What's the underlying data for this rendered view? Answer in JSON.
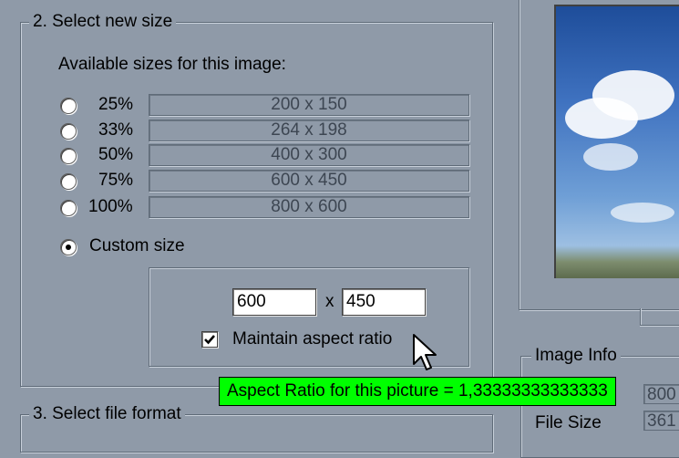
{
  "select_size": {
    "legend": "2. Select new size",
    "available_label": "Available sizes for this image:",
    "options": [
      {
        "percent": "25%",
        "dims": "200 x 150"
      },
      {
        "percent": "33%",
        "dims": "264 x 198"
      },
      {
        "percent": "50%",
        "dims": "400 x 300"
      },
      {
        "percent": "75%",
        "dims": "600 x 450"
      },
      {
        "percent": "100%",
        "dims": "800 x 600"
      }
    ],
    "custom_label": "Custom size",
    "custom_width": "600",
    "custom_times": "x",
    "custom_height": "450",
    "maintain_label": "Maintain aspect ratio"
  },
  "tooltip": "Aspect Ratio for this picture = 1,33333333333333",
  "select_format": {
    "legend": "3. Select file format"
  },
  "image_info": {
    "legend": "Image Info",
    "file_size_label": "File Size",
    "file_size_value": "361",
    "partial_value_1": "800"
  },
  "colors": {
    "tooltip_bg": "#00ff00",
    "window_bg": "#8f9aa8"
  }
}
